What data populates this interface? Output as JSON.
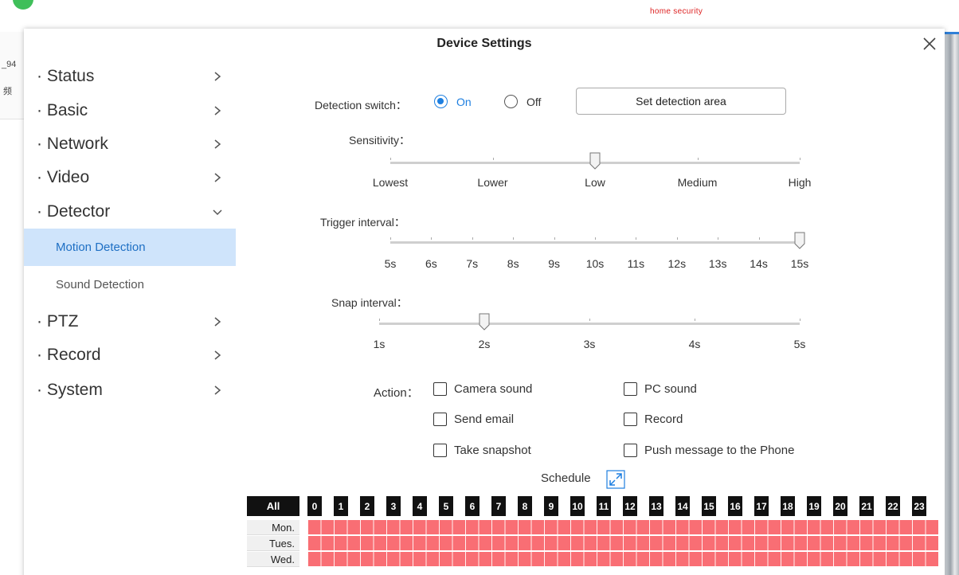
{
  "background": {
    "brand": "home security",
    "left_text_1": "_94",
    "left_text_2": "频"
  },
  "modal": {
    "title": "Device Settings"
  },
  "sidebar": {
    "items": [
      {
        "label": "· Status"
      },
      {
        "label": "· Basic"
      },
      {
        "label": "· Network"
      },
      {
        "label": "· Video"
      },
      {
        "label": "· Detector"
      },
      {
        "label": "· PTZ"
      },
      {
        "label": "· Record"
      },
      {
        "label": "· System"
      }
    ],
    "detector_sub": [
      {
        "label": "Motion Detection",
        "active": true
      },
      {
        "label": "Sound Detection",
        "active": false
      }
    ]
  },
  "detection": {
    "switch_label": "Detection switch：",
    "on_label": "On",
    "off_label": "Off",
    "selected": "On",
    "area_button": "Set detection area"
  },
  "sensitivity": {
    "label": "Sensitivity：",
    "ticks": [
      "Lowest",
      "Lower",
      "Low",
      "Medium",
      "High"
    ],
    "selected": "Low"
  },
  "trigger_interval": {
    "label": "Trigger interval：",
    "ticks": [
      "5s",
      "6s",
      "7s",
      "8s",
      "9s",
      "10s",
      "11s",
      "12s",
      "13s",
      "14s",
      "15s"
    ],
    "selected": "15s"
  },
  "snap_interval": {
    "label": "Snap interval：",
    "ticks": [
      "1s",
      "2s",
      "3s",
      "4s",
      "5s"
    ],
    "selected": "2s"
  },
  "action": {
    "label": "Action：",
    "options": {
      "camera_sound": "Camera sound",
      "pc_sound": "PC sound",
      "send_email": "Send email",
      "record": "Record",
      "take_snapshot": "Take snapshot",
      "push_message": "Push message to the Phone"
    }
  },
  "schedule": {
    "label": "Schedule",
    "all_label": "All",
    "hours": [
      "0",
      "1",
      "2",
      "3",
      "4",
      "5",
      "6",
      "7",
      "8",
      "9",
      "10",
      "11",
      "12",
      "13",
      "14",
      "15",
      "16",
      "17",
      "18",
      "19",
      "20",
      "21",
      "22",
      "23"
    ],
    "days": [
      "Mon.",
      "Tues.",
      "Wed."
    ],
    "active_color": "#f96e74"
  },
  "colors": {
    "accent": "#1e7fe0",
    "active_bg": "#cfe4fb"
  }
}
